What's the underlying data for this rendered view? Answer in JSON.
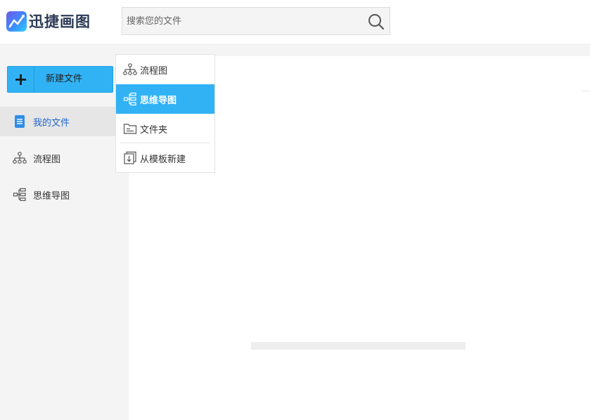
{
  "app": {
    "logo_text": "迅捷画图"
  },
  "search": {
    "placeholder": "搜索您的文件"
  },
  "sidebar": {
    "new_button_label": "新建文件",
    "items": [
      {
        "label": "我的文件",
        "icon": "document-icon",
        "active": true
      },
      {
        "label": "流程图",
        "icon": "flowchart-icon",
        "active": false
      },
      {
        "label": "思维导图",
        "icon": "mindmap-icon",
        "active": false
      }
    ]
  },
  "new_menu": {
    "items": [
      {
        "label": "流程图",
        "icon": "flowchart-icon",
        "active": false
      },
      {
        "label": "思维导图",
        "icon": "mindmap-icon",
        "active": true
      },
      {
        "label": "文件夹",
        "icon": "folder-icon",
        "active": false
      },
      {
        "label": "从模板新建",
        "icon": "template-icon",
        "active": false
      }
    ]
  },
  "colors": {
    "accent": "#31b2f5",
    "sidebar_bg": "#f4f4f4",
    "active_text": "#2266cc"
  }
}
